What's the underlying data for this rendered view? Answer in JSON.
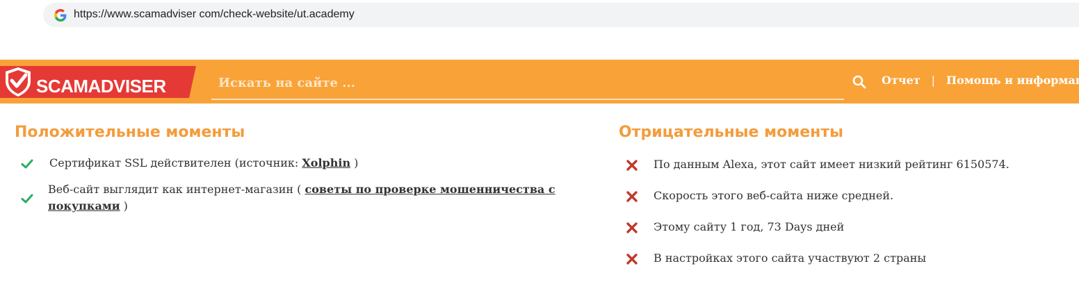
{
  "browser": {
    "url": "https://www.scamadviser com/check-website/ut.academy"
  },
  "header": {
    "logo_text": "SCAMADVISER",
    "search_placeholder": "Искать на сайте ...",
    "nav": {
      "report": "Отчет",
      "separator": "|",
      "help": "Помощь и информац"
    },
    "colors": {
      "bar": "#f9a237",
      "logo_bg": "#e53935"
    }
  },
  "positives": {
    "title": "Положительные моменты",
    "items": [
      {
        "text_before": "Сертификат SSL действителен (источник: ",
        "link": "Xolphin",
        "text_after": " )"
      },
      {
        "text_before": "Веб-сайт выглядит как интернет-магазин ( ",
        "link": "советы по проверке мошенничества с покупками",
        "text_after": " )"
      }
    ],
    "icon": "check-icon",
    "icon_color": "#27ae60"
  },
  "negatives": {
    "title": "Отрицательные моменты",
    "items": [
      {
        "text": "По данным Alexa, этот сайт имеет низкий рейтинг 6150574."
      },
      {
        "text": "Скорость этого веб-сайта ниже средней."
      },
      {
        "text": "Этому сайту 1 год, 73 Days дней"
      },
      {
        "text": "В настройках этого сайта участвуют 2 страны"
      }
    ],
    "icon": "cross-icon",
    "icon_color": "#c0392b"
  }
}
